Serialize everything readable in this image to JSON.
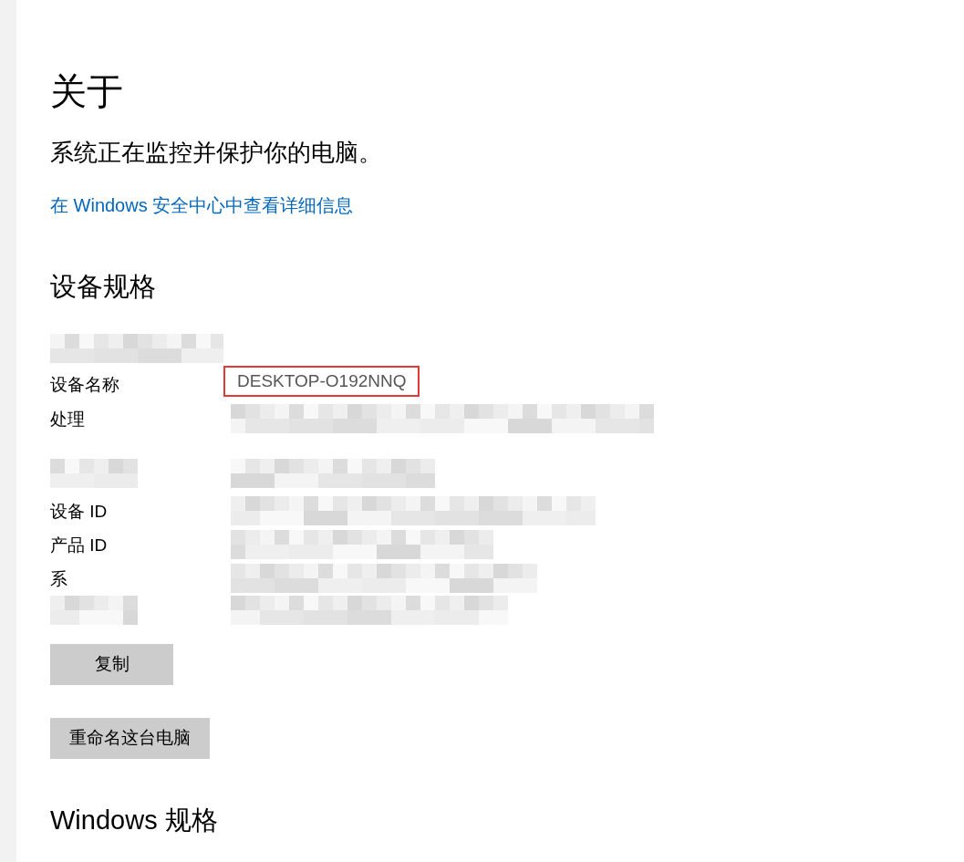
{
  "title": "关于",
  "status_message": "系统正在监控并保护你的电脑。",
  "security_link": "在 Windows 安全中心中查看详细信息",
  "device_specs": {
    "heading": "设备规格",
    "rows": [
      {},
      {
        "label": "设备名称",
        "value": "DESKTOP-O192NNQ",
        "highlighted": true
      },
      {
        "label": "处理"
      },
      {},
      {
        "label": "设备 ID"
      },
      {
        "label": "产品 ID"
      },
      {
        "label": "系"
      },
      {}
    ],
    "buttons": [
      "复制",
      "重命名这台电脑"
    ]
  },
  "windows_specs": {
    "heading": "Windows 规格"
  }
}
